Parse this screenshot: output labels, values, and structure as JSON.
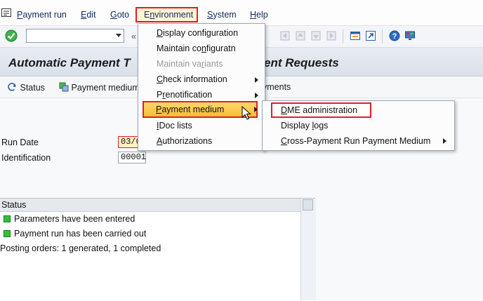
{
  "menubar": {
    "items": [
      {
        "label": "Payment run",
        "u": "P",
        "rest": "ayment run"
      },
      {
        "label": "Edit",
        "u": "E",
        "rest": "dit"
      },
      {
        "label": "Goto",
        "u": "G",
        "rest": "oto"
      },
      {
        "label": "Environment",
        "u": "n",
        "pre": "E",
        "rest": "vironment"
      },
      {
        "label": "System",
        "u": "S",
        "rest": "ystem"
      },
      {
        "label": "Help",
        "u": "H",
        "rest": "elp"
      }
    ]
  },
  "toolbar": {
    "command_value": "",
    "enter_icon": "check-circle-icon",
    "nav_glyph": "«"
  },
  "title": {
    "left": "Automatic Payment T",
    "right": "ent Requests"
  },
  "apptoolbar": {
    "status_label": "Status",
    "payment_medium_label": "Payment medium",
    "payments_tail": "yments"
  },
  "form": {
    "run_date_label": "Run Date",
    "run_date_value": "03/0",
    "identification_label": "Identification",
    "identification_value": "00001"
  },
  "status_panel": {
    "header": "Status",
    "rows": [
      "Parameters have been entered",
      "Payment run has been carried out"
    ],
    "posting": "Posting orders: 1 generated, 1 completed"
  },
  "environment_menu": {
    "items": [
      {
        "label": "Display configuration",
        "u": "D",
        "rest": "isplay configuration",
        "disabled": false
      },
      {
        "label": "Maintain configuratn",
        "pre": "Maintain co",
        "u": "n",
        "rest": "figuratn",
        "disabled": false
      },
      {
        "label": "Maintain variants",
        "pre": "Maintain va",
        "u": "r",
        "rest": "iants",
        "disabled": true
      },
      {
        "label": "Check information",
        "u": "C",
        "rest": "heck information",
        "disabled": false,
        "sub": true
      },
      {
        "label": "Prenotification",
        "pre": "P",
        "u": "r",
        "rest": "enotification",
        "disabled": false,
        "sub": true
      },
      {
        "label": "Payment medium",
        "u": "P",
        "rest": "ayment medium",
        "disabled": false,
        "sub": true
      },
      {
        "label": "IDoc lists",
        "u": "I",
        "rest": "Doc lists",
        "disabled": false
      },
      {
        "label": "Authorizations",
        "u": "A",
        "rest": "uthorizations",
        "disabled": false
      }
    ]
  },
  "payment_medium_submenu": {
    "items": [
      {
        "label": "DME administration",
        "u": "D",
        "rest": "ME administration"
      },
      {
        "label": "Display logs",
        "pre": "Display ",
        "u": "l",
        "rest": "ogs"
      },
      {
        "label": "Cross-Payment Run Payment Medium",
        "u": "C",
        "rest": "ross-Payment Run Payment Medium",
        "sub": true
      }
    ]
  },
  "colors": {
    "highlight_border": "#e11d2a",
    "status_green": "#2ec23a",
    "menu_text": "#102a5c"
  }
}
